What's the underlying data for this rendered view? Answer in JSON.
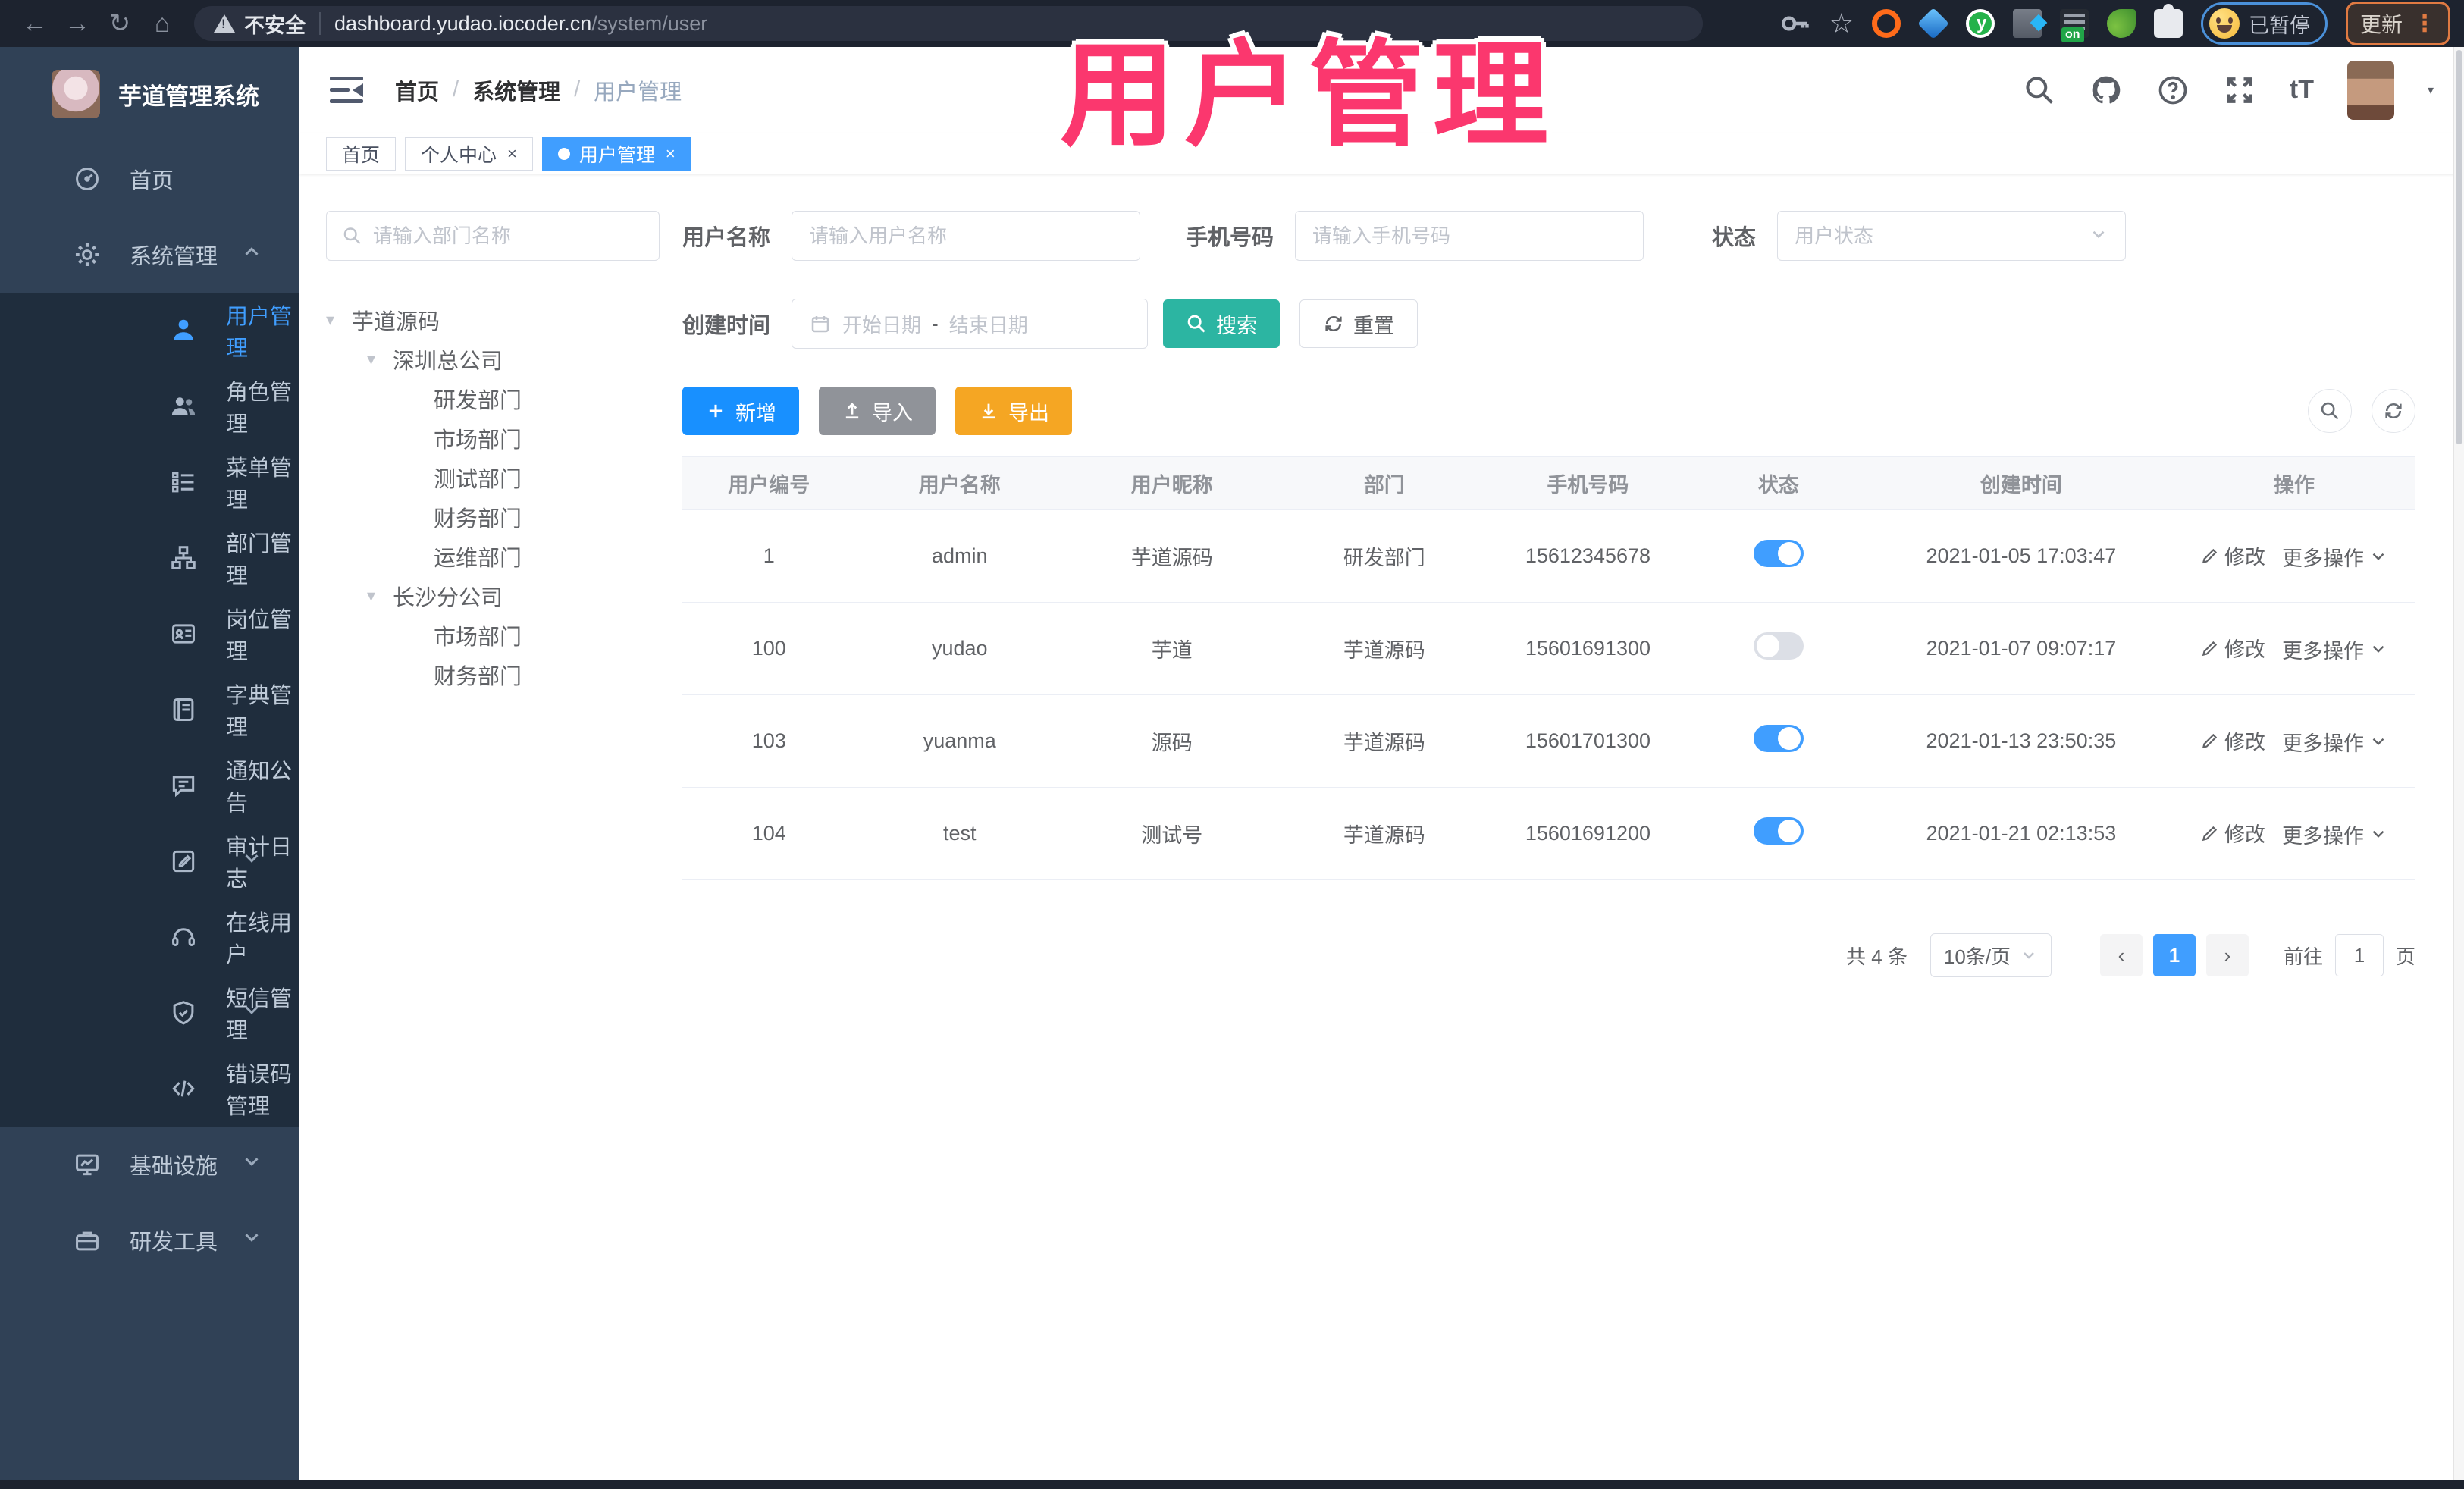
{
  "browser": {
    "unsafe_label": "不安全",
    "url_host": "dashboard.yudao.iocoder.cn",
    "url_path": "/system/user",
    "paused_label": "已暂停",
    "update_label": "更新"
  },
  "overlay_title": "用户管理",
  "sidebar": {
    "app_title": "芋道管理系统",
    "items": [
      {
        "icon": "dashboard-icon",
        "label": "首页",
        "sub": false,
        "chevron": "",
        "active": false
      },
      {
        "icon": "gear-icon",
        "label": "系统管理",
        "sub": false,
        "chevron": "up",
        "active": false
      },
      {
        "icon": "user-icon",
        "label": "用户管理",
        "sub": true,
        "chevron": "",
        "active": true
      },
      {
        "icon": "users-icon",
        "label": "角色管理",
        "sub": true,
        "chevron": "",
        "active": false
      },
      {
        "icon": "menu-list-icon",
        "label": "菜单管理",
        "sub": true,
        "chevron": "",
        "active": false
      },
      {
        "icon": "org-tree-icon",
        "label": "部门管理",
        "sub": true,
        "chevron": "",
        "active": false
      },
      {
        "icon": "id-badge-icon",
        "label": "岗位管理",
        "sub": true,
        "chevron": "",
        "active": false
      },
      {
        "icon": "dictionary-icon",
        "label": "字典管理",
        "sub": true,
        "chevron": "",
        "active": false
      },
      {
        "icon": "announcement-icon",
        "label": "通知公告",
        "sub": true,
        "chevron": "",
        "active": false
      },
      {
        "icon": "audit-log-icon",
        "label": "审计日志",
        "sub": true,
        "chevron": "down",
        "active": false
      },
      {
        "icon": "online-users-icon",
        "label": "在线用户",
        "sub": true,
        "chevron": "",
        "active": false
      },
      {
        "icon": "sms-icon",
        "label": "短信管理",
        "sub": true,
        "chevron": "down",
        "active": false
      },
      {
        "icon": "error-code-icon",
        "label": "错误码管理",
        "sub": true,
        "chevron": "",
        "active": false
      },
      {
        "icon": "infrastructure-icon",
        "label": "基础设施",
        "sub": false,
        "chevron": "down",
        "active": false
      },
      {
        "icon": "dev-tools-icon",
        "label": "研发工具",
        "sub": false,
        "chevron": "down",
        "active": false
      }
    ]
  },
  "header": {
    "breadcrumb": [
      "首页",
      "系统管理",
      "用户管理"
    ]
  },
  "tabs": [
    {
      "label": "首页",
      "closable": false,
      "active": false
    },
    {
      "label": "个人中心",
      "closable": true,
      "active": false
    },
    {
      "label": "用户管理",
      "closable": true,
      "active": true
    }
  ],
  "dept_panel": {
    "search_placeholder": "请输入部门名称",
    "tree": [
      {
        "label": "芋道源码",
        "depth": 0,
        "expandable": true
      },
      {
        "label": "深圳总公司",
        "depth": 1,
        "expandable": true
      },
      {
        "label": "研发部门",
        "depth": 2,
        "expandable": false
      },
      {
        "label": "市场部门",
        "depth": 2,
        "expandable": false
      },
      {
        "label": "测试部门",
        "depth": 2,
        "expandable": false
      },
      {
        "label": "财务部门",
        "depth": 2,
        "expandable": false
      },
      {
        "label": "运维部门",
        "depth": 2,
        "expandable": false
      },
      {
        "label": "长沙分公司",
        "depth": 1,
        "expandable": true
      },
      {
        "label": "市场部门",
        "depth": 2,
        "expandable": false
      },
      {
        "label": "财务部门",
        "depth": 2,
        "expandable": false
      }
    ]
  },
  "filter": {
    "username_label": "用户名称",
    "username_placeholder": "请输入用户名称",
    "mobile_label": "手机号码",
    "mobile_placeholder": "请输入手机号码",
    "status_label": "状态",
    "status_placeholder": "用户状态",
    "created_label": "创建时间",
    "date_start_placeholder": "开始日期",
    "date_separator": "-",
    "date_end_placeholder": "结束日期",
    "search_label": "搜索",
    "reset_label": "重置"
  },
  "toolbar": {
    "add_label": "新增",
    "import_label": "导入",
    "export_label": "导出"
  },
  "table": {
    "columns": [
      "用户编号",
      "用户名称",
      "用户昵称",
      "部门",
      "手机号码",
      "状态",
      "创建时间",
      "操作"
    ],
    "edit_label": "修改",
    "more_label": "更多操作",
    "rows": [
      {
        "id": "1",
        "username": "admin",
        "nickname": "芋道源码",
        "dept": "研发部门",
        "mobile": "15612345678",
        "status": true,
        "created": "2021-01-05 17:03:47"
      },
      {
        "id": "100",
        "username": "yudao",
        "nickname": "芋道",
        "dept": "芋道源码",
        "mobile": "15601691300",
        "status": false,
        "created": "2021-01-07 09:07:17"
      },
      {
        "id": "103",
        "username": "yuanma",
        "nickname": "源码",
        "dept": "芋道源码",
        "mobile": "15601701300",
        "status": true,
        "created": "2021-01-13 23:50:35"
      },
      {
        "id": "104",
        "username": "test",
        "nickname": "测试号",
        "dept": "芋道源码",
        "mobile": "15601691200",
        "status": true,
        "created": "2021-01-21 02:13:53"
      }
    ]
  },
  "pagination": {
    "total": "共 4 条",
    "page_size": "10条/页",
    "current": "1",
    "goto_label": "前往",
    "goto_value": "1",
    "unit_label": "页"
  },
  "colors": {
    "primary_blue": "#409eff",
    "tab_active_blue": "#409eff",
    "search_teal": "#2cb5a2",
    "import_gray": "#909399",
    "export_orange": "#f5a623",
    "add_blue": "#1890ff",
    "sidebar_bg": "#304156",
    "submenu_bg": "#1f2d3d",
    "overlay_pink": "#fb376e"
  }
}
